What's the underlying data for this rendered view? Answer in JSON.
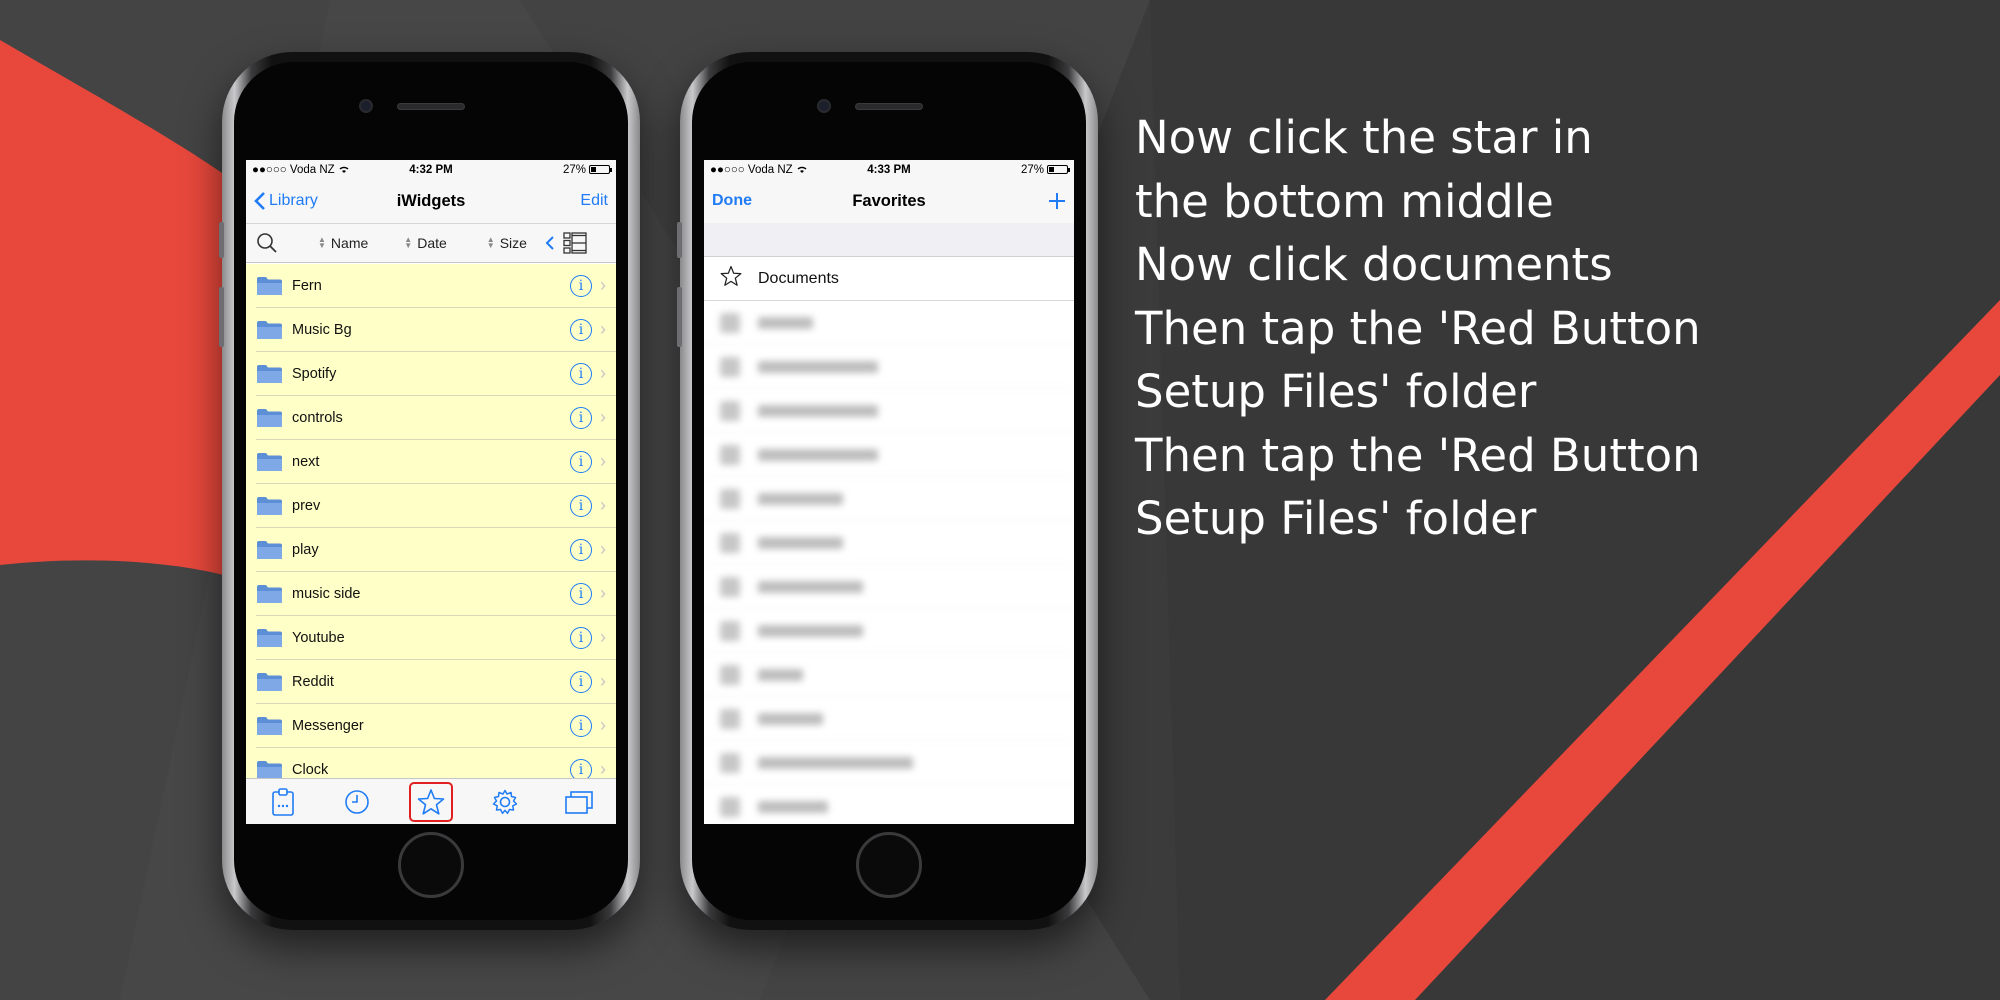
{
  "colors": {
    "accent_blue": "#1f7cf6",
    "background": "#3b3b3b",
    "red_stripe": "#e8483c",
    "list_yellow": "#ffffc8",
    "highlight_red": "#e02020"
  },
  "left_phone": {
    "status": {
      "carrier": "●●○○○ Voda NZ",
      "time": "4:32 PM",
      "battery": "27%",
      "battery_level": 0.27
    },
    "nav": {
      "back_label": "Library",
      "title": "iWidgets",
      "edit_label": "Edit"
    },
    "sort": {
      "name": "Name",
      "date": "Date",
      "size": "Size"
    },
    "rows": [
      {
        "label": "Fern"
      },
      {
        "label": "Music Bg"
      },
      {
        "label": "Spotify"
      },
      {
        "label": "controls"
      },
      {
        "label": "next"
      },
      {
        "label": "prev"
      },
      {
        "label": "play"
      },
      {
        "label": "music side"
      },
      {
        "label": "Youtube"
      },
      {
        "label": "Reddit"
      },
      {
        "label": "Messenger"
      },
      {
        "label": "Clock"
      }
    ],
    "tabs": [
      {
        "icon": "clipboard-icon"
      },
      {
        "icon": "clock-icon"
      },
      {
        "icon": "star-icon",
        "highlighted": true
      },
      {
        "icon": "gear-icon"
      },
      {
        "icon": "windows-icon"
      }
    ]
  },
  "right_phone": {
    "status": {
      "carrier": "●●○○○ Voda NZ",
      "time": "4:33 PM",
      "battery": "27%",
      "battery_level": 0.27
    },
    "nav": {
      "done_label": "Done",
      "title": "Favorites",
      "add_label": "+"
    },
    "favorites": [
      {
        "label": "Documents"
      }
    ],
    "blurred_count": 12
  },
  "instructions": [
    "Now click the star in",
    "the bottom middle",
    "Now click documents",
    "Then tap the 'Red Button",
    "Setup Files' folder",
    "Then tap the 'Red Button",
    "Setup Files' folder"
  ]
}
